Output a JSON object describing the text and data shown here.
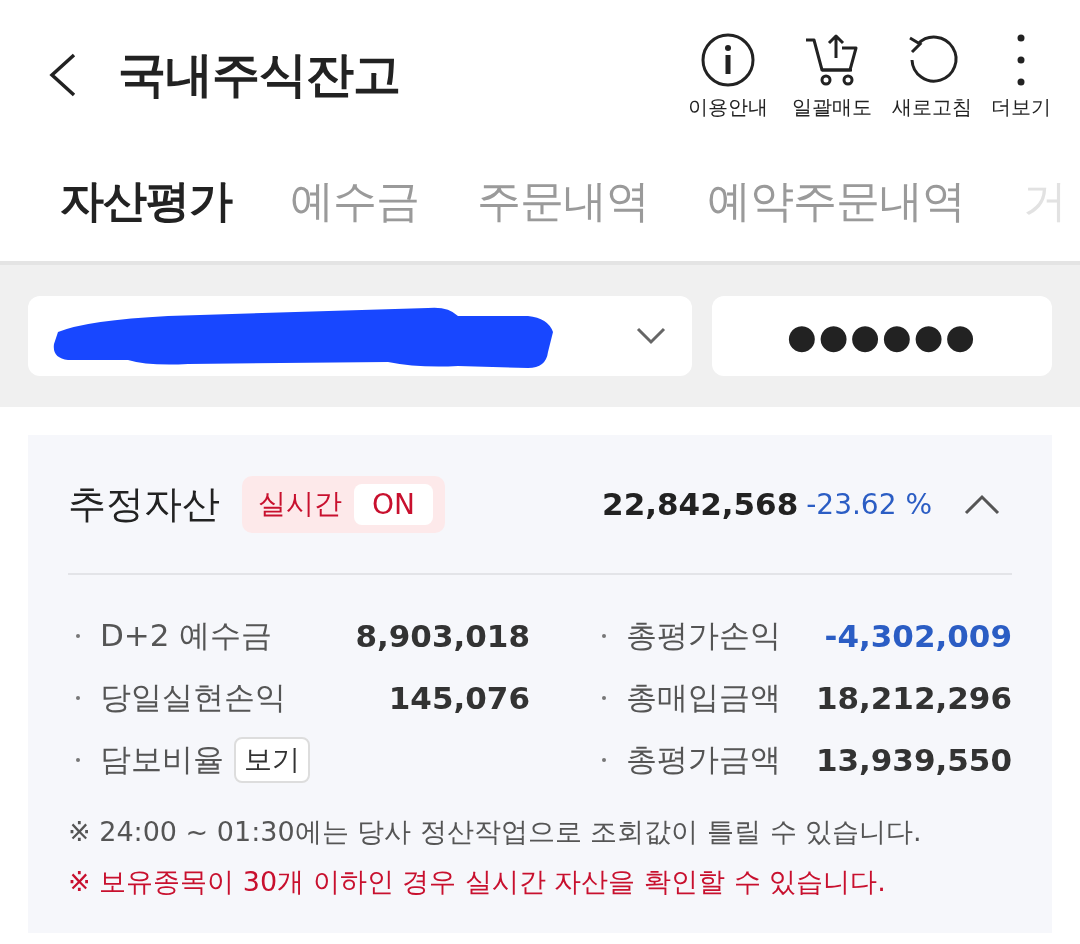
{
  "header": {
    "title": "국내주식잔고",
    "actions": [
      {
        "kind": "info",
        "label": "이용안내"
      },
      {
        "kind": "cart",
        "label": "일괄매도"
      },
      {
        "kind": "refresh",
        "label": "새로고침"
      },
      {
        "kind": "more",
        "label": "더보기"
      }
    ]
  },
  "tabs": [
    {
      "label": "자산평가",
      "selected": true,
      "cut": false
    },
    {
      "label": "예수금",
      "selected": false,
      "cut": false
    },
    {
      "label": "주문내역",
      "selected": false,
      "cut": false
    },
    {
      "label": "예약주문내역",
      "selected": false,
      "cut": false
    },
    {
      "label": "거",
      "selected": false,
      "cut": true
    }
  ],
  "account": {
    "redacted": true,
    "password": "●●●●●●"
  },
  "summary": {
    "title": "추정자산",
    "realtime": {
      "label": "실시간",
      "state": "ON",
      "on": true
    },
    "total": "22,842,568",
    "change": "-23.62 %",
    "change_negative": true,
    "expanded": true,
    "left": [
      {
        "label": "D+2 예수금",
        "value": "8,903,018",
        "negative": false,
        "kind": "value"
      },
      {
        "label": "당일실현손익",
        "value": "145,076",
        "negative": false,
        "kind": "value"
      },
      {
        "label": "담보비율",
        "button": "보기",
        "kind": "button"
      }
    ],
    "right": [
      {
        "label": "총평가손익",
        "value": "-4,302,009",
        "negative": true,
        "kind": "value"
      },
      {
        "label": "총매입금액",
        "value": "18,212,296",
        "negative": false,
        "kind": "value"
      },
      {
        "label": "총평가금액",
        "value": "13,939,550",
        "negative": false,
        "kind": "value"
      }
    ],
    "notes": [
      {
        "text": "※  24:00 ~ 01:30에는 당사 정산작업으로 조회값이 틀릴 수 있습니다.",
        "warning": false
      },
      {
        "text": "※  보유종목이 30개 이하인 경우 실시간 자산을 확인할 수 있습니다.",
        "warning": true
      }
    ]
  }
}
